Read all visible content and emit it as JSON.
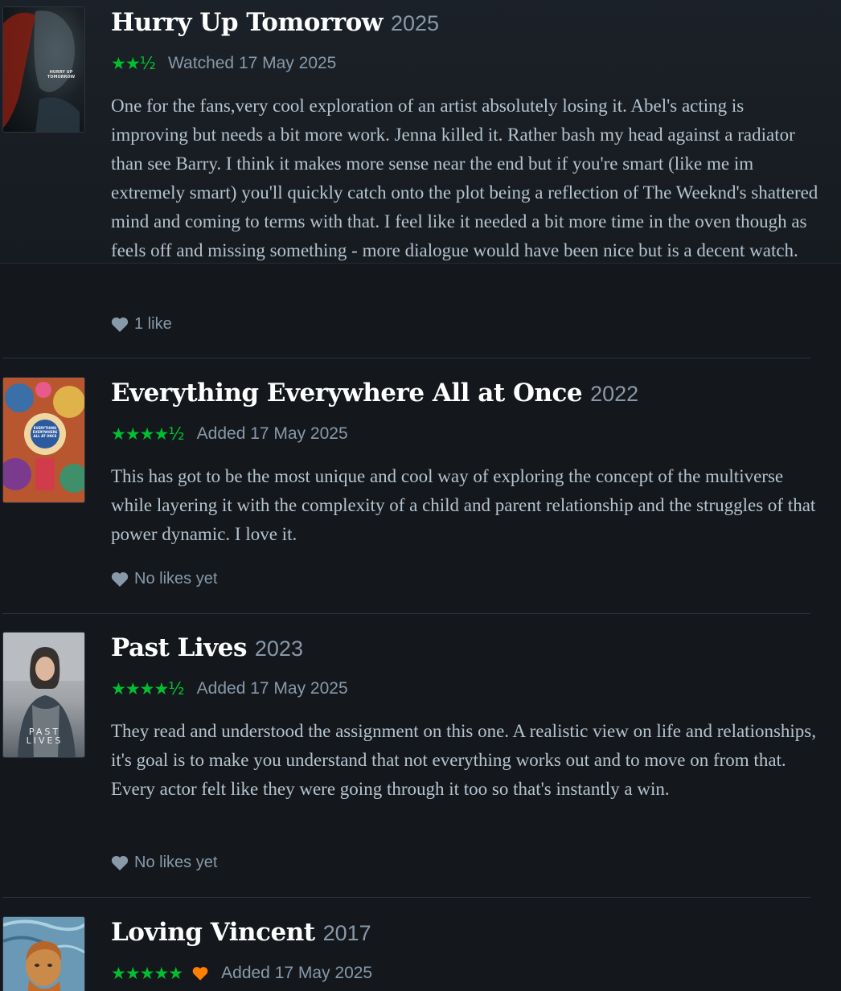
{
  "colors": {
    "background": "#14181c",
    "star_green": "#00c030",
    "liked_orange": "#ff8000",
    "title_white": "#ffffff",
    "muted": "#8899aa"
  },
  "reviews": [
    {
      "title": "Hurry Up Tomorrow",
      "year": "2025",
      "rating": "★★½",
      "rating_value": 2.5,
      "date_text": "Watched 17 May 2025",
      "poster_text": "HURRY UP TOMORROW",
      "body": "One for the fans,very cool exploration of an artist absolutely losing it. Abel's acting is improving but needs a bit more work. Jenna killed it. Rather bash my head against a radiator than see Barry. I think it makes more sense near the end but if you're smart (like me im extremely smart) you'll quickly catch onto the plot being a reflection of The Weeknd's shattered mind and coming to terms with that. I feel like it needed a bit more time in the oven though as feels off and missing something - more dialogue would have been nice but is a decent watch.",
      "likes": "1 like",
      "liked": false
    },
    {
      "title": "Everything Everywhere All at Once",
      "year": "2022",
      "rating": "★★★★½",
      "rating_value": 4.5,
      "date_text": "Added 17 May 2025",
      "poster_text": "EVERYTHING EVERYWHERE ALL AT ONCE",
      "body": "This has got to be the most unique and cool way of exploring the concept of the multiverse while layering it with the complexity of a child and parent relationship and the struggles of that power dynamic. I love it.",
      "likes": "No likes yet",
      "liked": false
    },
    {
      "title": "Past Lives",
      "year": "2023",
      "rating": "★★★★½",
      "rating_value": 4.5,
      "date_text": "Added 17 May 2025",
      "poster_text": "PAST LIVES",
      "body": "They read and understood the assignment on this one. A realistic view on life and relationships, it's goal is to make you understand that not everything works out and to move on from that. Every actor felt like they were going through it too so that's instantly a win.",
      "likes": "No likes yet",
      "liked": false
    },
    {
      "title": "Loving Vincent",
      "year": "2017",
      "rating": "★★★★★",
      "rating_value": 5,
      "date_text": "Added 17 May 2025",
      "liked": true
    }
  ]
}
